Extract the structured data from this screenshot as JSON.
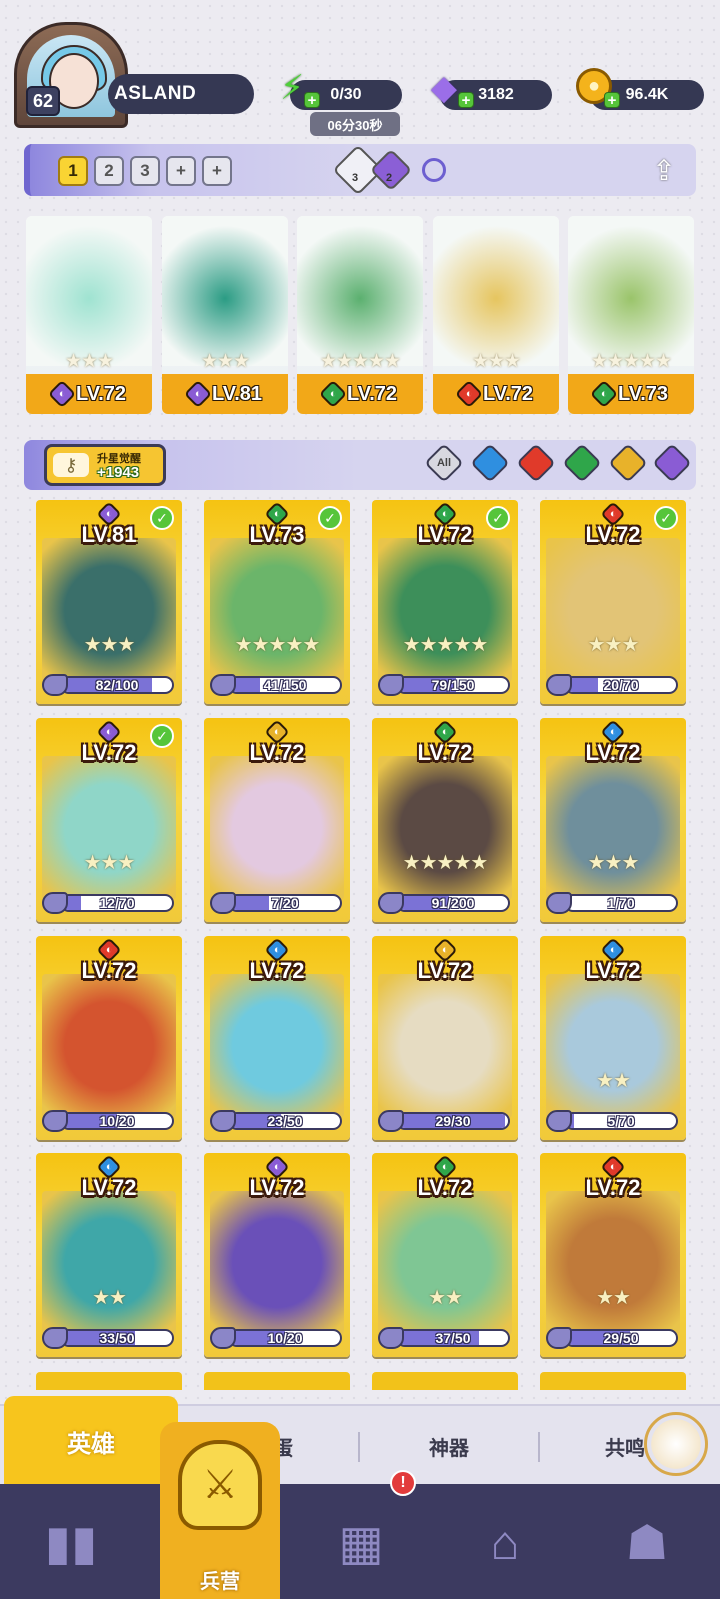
{
  "player": {
    "level": "62",
    "name": "ASLAND"
  },
  "resources": {
    "energy": "0/30",
    "energy_timer": "06分30秒",
    "gems": "3182",
    "gold": "96.4K"
  },
  "team_tabs": [
    "1",
    "2",
    "3",
    "+",
    "+"
  ],
  "crystals": [
    {
      "count": "3",
      "color": "#e8e8f0"
    },
    {
      "count": "2",
      "color": "#8b5fd6"
    }
  ],
  "element_colors": {
    "dark": "#8a5cd4",
    "nature": "#2fa64a",
    "fire": "#e03a2a",
    "water": "#2f8fe0",
    "light": "#e8b22a"
  },
  "team": [
    {
      "level": "LV.72",
      "element": "dark",
      "stars": "★★★",
      "art": "#9fe3d1"
    },
    {
      "level": "LV.81",
      "element": "dark",
      "stars": "★★★",
      "art": "#2b9c84"
    },
    {
      "level": "LV.72",
      "element": "nature",
      "stars": "★★★★★",
      "art": "#5bb06f"
    },
    {
      "level": "LV.72",
      "element": "fire",
      "stars": "★★★",
      "art": "#e6c55f"
    },
    {
      "level": "LV.73",
      "element": "nature",
      "stars": "★★★★★",
      "art": "#9ac46a"
    }
  ],
  "awaken": {
    "label": "升星觉醒",
    "value": "+1943"
  },
  "filters": [
    {
      "label": "All",
      "color": "#d8d8e0"
    },
    {
      "label": "",
      "color": "#2f8fe0"
    },
    {
      "label": "",
      "color": "#e03a2a"
    },
    {
      "label": "",
      "color": "#2fa64a"
    },
    {
      "label": "",
      "color": "#e8b22a"
    },
    {
      "label": "",
      "color": "#8a5cd4"
    }
  ],
  "heroes": [
    {
      "level": "LV.81",
      "element": "dark",
      "checked": true,
      "stars": "★★★",
      "shards": "82/100",
      "fill": 0.82,
      "art": "#3a6f6a"
    },
    {
      "level": "LV.73",
      "element": "nature",
      "checked": true,
      "stars": "★★★★★",
      "shards": "41/150",
      "fill": 0.27,
      "art": "#6bb56a"
    },
    {
      "level": "LV.72",
      "element": "nature",
      "checked": true,
      "stars": "★★★★★",
      "shards": "79/150",
      "fill": 0.53,
      "art": "#3d8f5a"
    },
    {
      "level": "LV.72",
      "element": "fire",
      "checked": true,
      "stars": "★★★",
      "shards": "20/70",
      "fill": 0.29,
      "art": "#e2c476"
    },
    {
      "level": "LV.72",
      "element": "dark",
      "checked": true,
      "stars": "★★★",
      "shards": "12/70",
      "fill": 0.17,
      "art": "#8fd6c8"
    },
    {
      "level": "LV.72",
      "element": "light",
      "checked": false,
      "stars": "",
      "shards": "7/20",
      "fill": 0.35,
      "art": "#e3c9e0"
    },
    {
      "level": "LV.72",
      "element": "nature",
      "checked": false,
      "stars": "★★★★★",
      "shards": "91/200",
      "fill": 0.46,
      "art": "#5b4a44"
    },
    {
      "level": "LV.72",
      "element": "water",
      "checked": false,
      "stars": "★★★",
      "shards": "1/70",
      "fill": 0.01,
      "art": "#6f8f9c"
    },
    {
      "level": "LV.72",
      "element": "fire",
      "checked": false,
      "stars": "",
      "shards": "10/20",
      "fill": 0.5,
      "art": "#d4542f"
    },
    {
      "level": "LV.72",
      "element": "water",
      "checked": false,
      "stars": "",
      "shards": "23/50",
      "fill": 0.46,
      "art": "#6fcadf"
    },
    {
      "level": "LV.72",
      "element": "light",
      "checked": false,
      "stars": "",
      "shards": "29/30",
      "fill": 0.97,
      "art": "#e6dcc2"
    },
    {
      "level": "LV.72",
      "element": "water",
      "checked": false,
      "stars": "★★",
      "shards": "5/70",
      "fill": 0.07,
      "art": "#a9c9dc"
    },
    {
      "level": "LV.72",
      "element": "water",
      "checked": false,
      "stars": "★★",
      "shards": "33/50",
      "fill": 0.66,
      "art": "#3fa7a8"
    },
    {
      "level": "LV.72",
      "element": "dark",
      "checked": false,
      "stars": "",
      "shards": "10/20",
      "fill": 0.5,
      "art": "#6a50b8"
    },
    {
      "level": "LV.72",
      "element": "nature",
      "checked": false,
      "stars": "★★",
      "shards": "37/50",
      "fill": 0.74,
      "art": "#7fc694"
    },
    {
      "level": "LV.72",
      "element": "fire",
      "checked": false,
      "stars": "★★",
      "shards": "29/50",
      "fill": 0.58,
      "art": "#c07a3a"
    }
  ],
  "sub_tabs": [
    "英雄",
    "孵蛋",
    "神器",
    "共鸣"
  ],
  "nav": {
    "active_label": "兵营",
    "alert": "!"
  }
}
